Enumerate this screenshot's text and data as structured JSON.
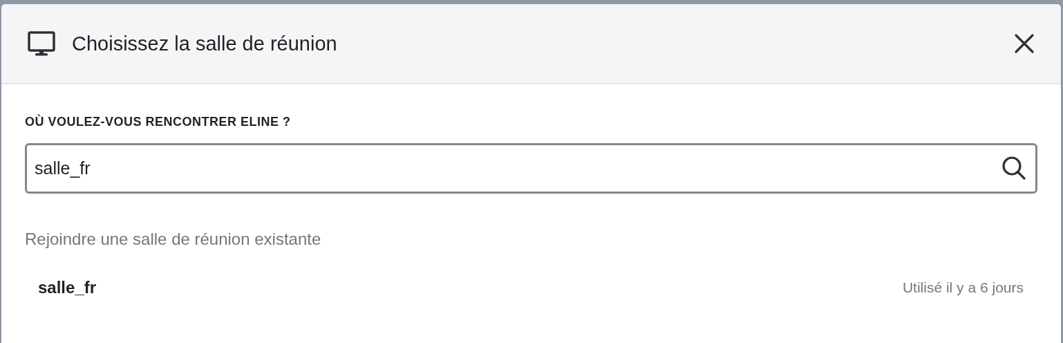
{
  "dialog": {
    "title": "Choisissez la salle de réunion"
  },
  "search": {
    "label": "OÙ VOULEZ-VOUS RENCONTRER ELINE ?",
    "value": "salle_fr"
  },
  "section_heading": "Rejoindre une salle de réunion existante",
  "rooms": [
    {
      "name": "salle_fr",
      "last_used": "Utilisé il y a 6 jours"
    }
  ]
}
